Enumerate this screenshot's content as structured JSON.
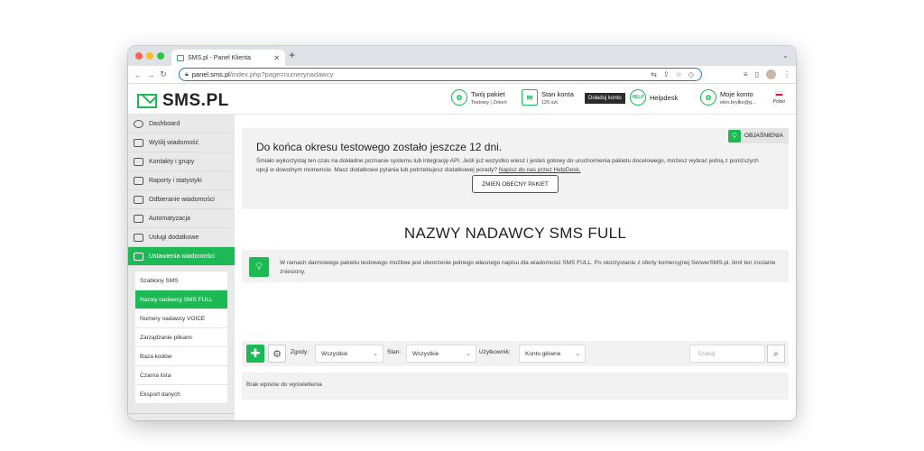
{
  "browser": {
    "tab_title": "SMS.pl - Panel Klienta",
    "new_tab": "+",
    "url_host": "panel.sms.pl",
    "url_path": "/index.php?page=numerynadawcy"
  },
  "header": {
    "brand": "SMS.PL",
    "package_title": "Twój pakiet",
    "package_sub": "Testowy | Zmień",
    "account_title": "Stan konta",
    "account_sub": "120 szt.",
    "topup_label": "Doładuj konto",
    "helpdesk_label": "Helpdesk",
    "myaccount_title": "Moje konto",
    "myaccount_sub": "elon.bryłko@g...",
    "language": "Polski"
  },
  "sidebar": {
    "items": [
      {
        "label": "Dashboard"
      },
      {
        "label": "Wyślij wiadomość"
      },
      {
        "label": "Kontakty i grupy"
      },
      {
        "label": "Raporty i statystyki"
      },
      {
        "label": "Odbieranie wiadomości"
      },
      {
        "label": "Automatyzacja"
      },
      {
        "label": "Usługi dodatkowe"
      },
      {
        "label": "Ustawienia wiadomości"
      }
    ],
    "submenu": [
      {
        "label": "Szablony SMS"
      },
      {
        "label": "Nazwy nadawcy SMS FULL"
      },
      {
        "label": "Numery nadawcy VOICE"
      },
      {
        "label": "Zarządzanie plikami"
      },
      {
        "label": "Baza kodów"
      },
      {
        "label": "Czarna lista"
      },
      {
        "label": "Eksport danych"
      }
    ]
  },
  "notice": {
    "explain_label": "OBJAŚNIENIA",
    "heading": "Do końca okresu testowego zostało jeszcze 12 dni.",
    "text": "Śmiało wykorzystaj ten czas na dokładne poznanie systemu lub integrację API. Jeśli już wszystko wiesz i jesteś gotowy do uruchomienia pakietu docelowego, możesz wybrać jedną z poniższych opcji w dowolnym momencie. Masz dodatkowe pytania lub potrzebujesz dodatkowej porady?",
    "link": "Napisz do nas przez HelpDesk.",
    "button": "ZMIEŃ OBECNY PAKIET"
  },
  "page_title": "NAZWY NADAWCY SMS FULL",
  "info_text": "W ramach darmowego pakietu testowego możliwe jest utworzenie jednego własnego napisu dla wiadomości SMS FULL. Po skorzystaniu z oferty komercyjnej SerwerSMS.pl, limit ten zostanie zniesiony.",
  "filters": {
    "consent_label": "Zgody:",
    "consent_value": "Wszystkie",
    "state_label": "Stan:",
    "state_value": "Wszystkie",
    "user_label": "Użytkownik:",
    "user_value": "Konto główne",
    "search_placeholder": "Szukaj"
  },
  "empty_text": "Brak wpisów do wyświetlenia",
  "colors": {
    "accent": "#1db954"
  }
}
